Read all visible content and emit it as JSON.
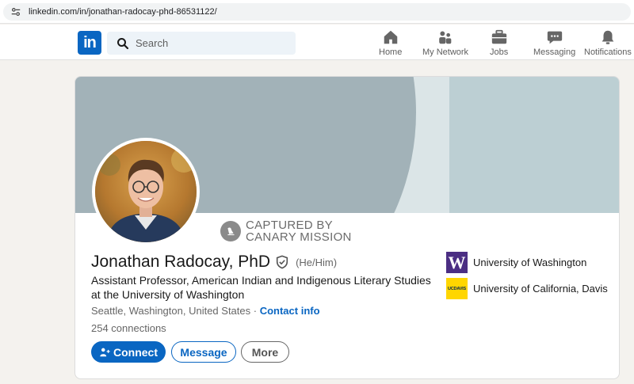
{
  "browser": {
    "url": "linkedin.com/in/jonathan-radocay-phd-86531122/"
  },
  "nav": {
    "logo": "in",
    "search_placeholder": "Search",
    "items": [
      {
        "label": "Home",
        "icon": "home-icon"
      },
      {
        "label": "My Network",
        "icon": "network-icon"
      },
      {
        "label": "Jobs",
        "icon": "briefcase-icon"
      },
      {
        "label": "Messaging",
        "icon": "messaging-icon"
      },
      {
        "label": "Notifications",
        "icon": "bell-icon"
      }
    ]
  },
  "profile": {
    "watermark_line1": "CAPTURED BY",
    "watermark_line2": "CANARY MISSION",
    "name": "Jonathan Radocay, PhD",
    "pronouns": "(He/Him)",
    "headline": "Assistant Professor, American Indian and Indigenous Literary Studies at the University of Washington",
    "location": "Seattle, Washington, United States",
    "separator": " · ",
    "contact_label": "Contact info",
    "connections": "254 connections",
    "buttons": {
      "connect": "Connect",
      "message": "Message",
      "more": "More"
    },
    "education": [
      {
        "name": "University of Washington",
        "logo_text": "W",
        "logo_bg": "#4b2e83"
      },
      {
        "name": "University of California, Davis",
        "logo_text": "UCDAVIS",
        "logo_bg": "#ffd600"
      }
    ]
  },
  "colors": {
    "brand": "#0a66c2",
    "banner_dark": "#a2b2b8",
    "banner_light": "#dbe5e7"
  }
}
